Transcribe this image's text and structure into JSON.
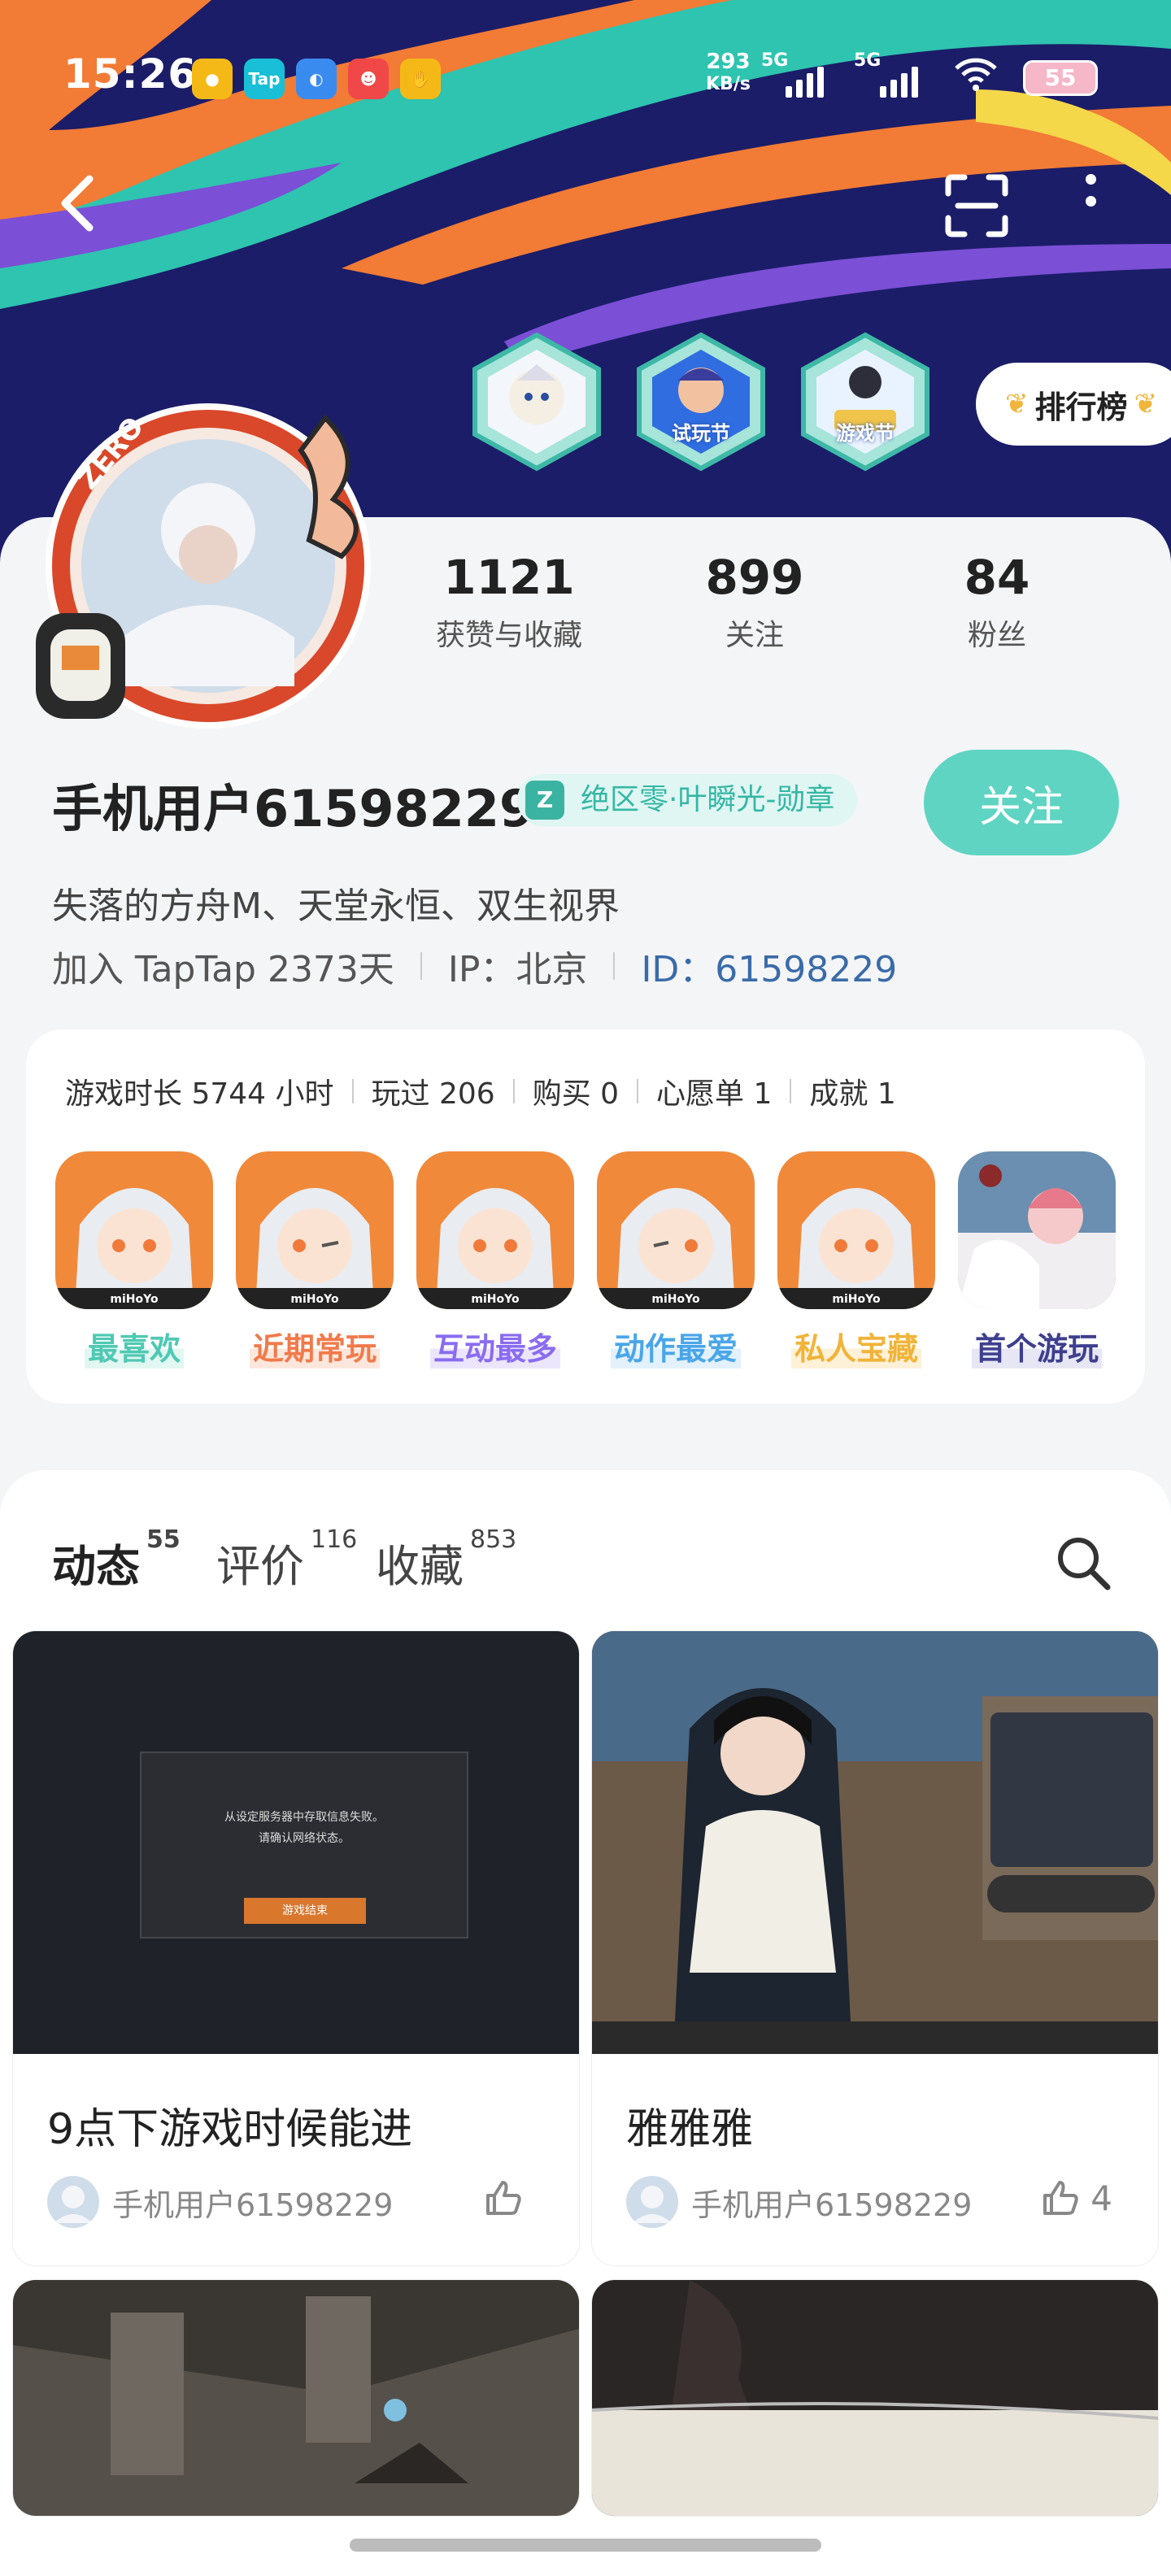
{
  "status_bar": {
    "time": "15:26",
    "net_speed": "293",
    "net_unit": "KB/s",
    "sim1": "5G",
    "sim2": "5G",
    "battery": "55",
    "app_icons": [
      "Tap"
    ]
  },
  "header": {
    "rank_label": "排行榜",
    "badges": [
      "",
      "试玩节",
      "游戏节"
    ]
  },
  "profile": {
    "stats": [
      {
        "value": "1121",
        "label": "获赞与收藏"
      },
      {
        "value": "899",
        "label": "关注"
      },
      {
        "value": "84",
        "label": "粉丝"
      }
    ],
    "username": "手机用户61598229",
    "medal": "绝区零·叶瞬光-勋章",
    "follow_label": "关注",
    "bio": "失落的方舟M、天堂永恒、双生视界",
    "joined": "加入 TapTap 2373天",
    "ip": "IP：北京",
    "id": "ID：61598229"
  },
  "games": {
    "playtime": "游戏时长 5744 小时",
    "played": "玩过 206",
    "bought": "购买 0",
    "wishlist": "心愿单 1",
    "achievements": "成就 1",
    "icons": [
      {
        "tag": "最喜欢",
        "color": "#4fc9b3"
      },
      {
        "tag": "近期常玩",
        "color": "#f07a4b"
      },
      {
        "tag": "互动最多",
        "color": "#8a6cf0"
      },
      {
        "tag": "动作最爱",
        "color": "#4aa6e8"
      },
      {
        "tag": "私人宝藏",
        "color": "#f0b43a"
      },
      {
        "tag": "首个游玩",
        "color": "#3f3f8f"
      }
    ]
  },
  "feed": {
    "tabs": [
      {
        "label": "动态",
        "count": "55"
      },
      {
        "label": "评价",
        "count": "116"
      },
      {
        "label": "收藏",
        "count": "853"
      }
    ],
    "posts": [
      {
        "title": "9点下游戏时候能进",
        "author": "手机用户61598229",
        "likes": "",
        "dialog_line1": "从设定服务器中存取信息失败。",
        "dialog_line2": "请确认网络状态。",
        "dialog_button": "游戏结束"
      },
      {
        "title": "雅雅雅",
        "author": "手机用户61598229",
        "likes": "4"
      }
    ]
  },
  "colors": {
    "accent": "#5fd4c2",
    "id_link": "#3a6ba8"
  }
}
